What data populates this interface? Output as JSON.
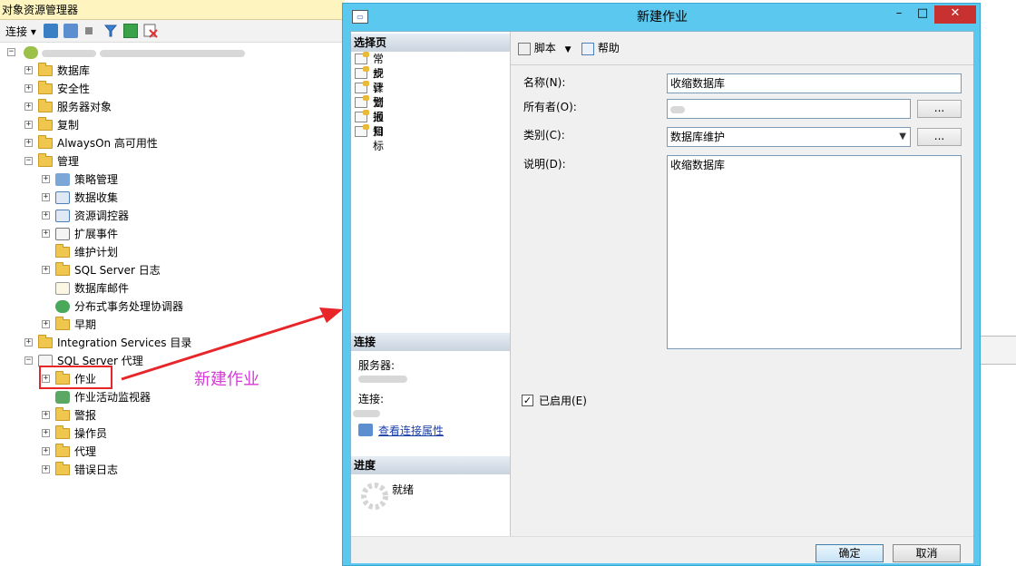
{
  "object_explorer": {
    "title": "对象资源管理器",
    "toolbar": {
      "connect_label": "连接"
    },
    "server_node": {
      "name": "",
      "detail": ""
    },
    "nodes": {
      "databases": "数据库",
      "security": "安全性",
      "server_objects": "服务器对象",
      "replication": "复制",
      "alwayson": "AlwaysOn 高可用性",
      "management": "管理",
      "policy_management": "策略管理",
      "data_collection": "数据收集",
      "resource_governor": "资源调控器",
      "extended_events": "扩展事件",
      "maintenance_plans": "维护计划",
      "sql_server_logs": "SQL Server 日志",
      "database_mail": "数据库邮件",
      "dtc": "分布式事务处理协调器",
      "legacy": "早期",
      "integration_services": "Integration Services 目录",
      "sql_server_agent": "SQL Server 代理",
      "jobs": "作业",
      "job_activity_monitor": "作业活动监视器",
      "alerts": "警报",
      "operators": "操作员",
      "proxies": "代理",
      "error_logs": "错误日志"
    }
  },
  "annotation": {
    "text": "新建作业",
    "color": "#d63ad6",
    "highlight_color": "#e8262a"
  },
  "dialog": {
    "title": "新建作业",
    "window_buttons": {
      "minimize": "–",
      "maximize": "□",
      "close": "✕"
    },
    "select_page_header": "选择页",
    "pages": [
      "常规",
      "步骤",
      "计划",
      "警报",
      "通知",
      "目标"
    ],
    "connection_header": "连接",
    "server_label": "服务器:",
    "connection_label": "连接:",
    "view_connection_link": "查看连接属性",
    "progress_header": "进度",
    "progress_status": "就绪",
    "toolbar": {
      "script_label": "脚本",
      "help_label": "帮助"
    },
    "form": {
      "name_label": "名称(N):",
      "name_value": "收缩数据库",
      "owner_label": "所有者(O):",
      "category_label": "类别(C):",
      "category_value": "数据库维护",
      "description_label": "说明(D):",
      "description_value": "收缩数据库",
      "browse_button": "...",
      "enabled_label": "已启用(E)",
      "enabled_checked": true
    },
    "footer": {
      "ok": "确定",
      "cancel": "取消"
    }
  },
  "colors": {
    "dialog_frame": "#5bc8ef",
    "close_button": "#c7312f",
    "oe_title_bg": "#fdf4bf"
  }
}
